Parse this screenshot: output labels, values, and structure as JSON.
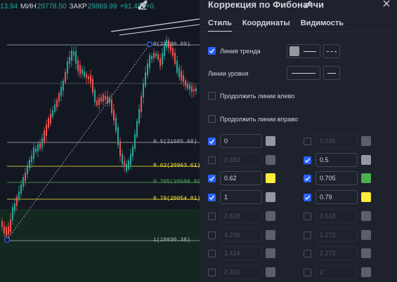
{
  "chart": {
    "top_info": {
      "prefix": "13.94",
      "min_label": "МИН",
      "min_value": "29778.50",
      "close_label": "ЗАКР",
      "close_value": "29869.99",
      "change": "+91.48 (+0."
    },
    "fib_labels": [
      {
        "text": "0(24280.99)",
        "color": "#b2b5be"
      },
      {
        "text": "0.5(21605.68)",
        "color": "#b2b5be"
      },
      {
        "text": "0.62(20963.61)",
        "color": "#ffeb3b"
      },
      {
        "text": "0.705(20508.81)",
        "color": "#4caf50"
      },
      {
        "text": "0.79(20054.01)",
        "color": "#ffeb3b"
      },
      {
        "text": "1(18930.38)",
        "color": "#b2b5be"
      }
    ],
    "colors": {
      "up": "#26a69a",
      "down": "#ef5350",
      "background": "#131722",
      "zone": "#163a26"
    }
  },
  "panel": {
    "title": "Коррекция по Фибоначчи",
    "tabs": [
      "Стиль",
      "Координаты",
      "Видимость"
    ],
    "trend_line_label": "Линия тренда",
    "level_lines_label": "Линии уровня",
    "extend_left_label": "Продолжить линии влево",
    "extend_right_label": "Продолжить линии вправо",
    "levels": [
      {
        "value": "0",
        "checked": true,
        "color": "#9598a1"
      },
      {
        "value": "0.236",
        "checked": false,
        "color": "#5d606b"
      },
      {
        "value": "0.382",
        "checked": false,
        "color": "#5d606b"
      },
      {
        "value": "0.5",
        "checked": true,
        "color": "#9598a1"
      },
      {
        "value": "0.62",
        "checked": true,
        "color": "#ffeb3b"
      },
      {
        "value": "0.705",
        "checked": true,
        "color": "#4caf50"
      },
      {
        "value": "1",
        "checked": true,
        "color": "#9598a1"
      },
      {
        "value": "0.79",
        "checked": true,
        "color": "#ffeb3b"
      },
      {
        "value": "2.618",
        "checked": false,
        "color": "#5d606b"
      },
      {
        "value": "3.618",
        "checked": false,
        "color": "#5d606b"
      },
      {
        "value": "4.236",
        "checked": false,
        "color": "#5d606b"
      },
      {
        "value": "1.272",
        "checked": false,
        "color": "#5d606b"
      },
      {
        "value": "1.414",
        "checked": false,
        "color": "#5d606b"
      },
      {
        "value": "2.272",
        "checked": false,
        "color": "#5d606b"
      },
      {
        "value": "2.414",
        "checked": false,
        "color": "#5d606b"
      },
      {
        "value": "2",
        "checked": false,
        "color": "#5d606b"
      }
    ]
  }
}
